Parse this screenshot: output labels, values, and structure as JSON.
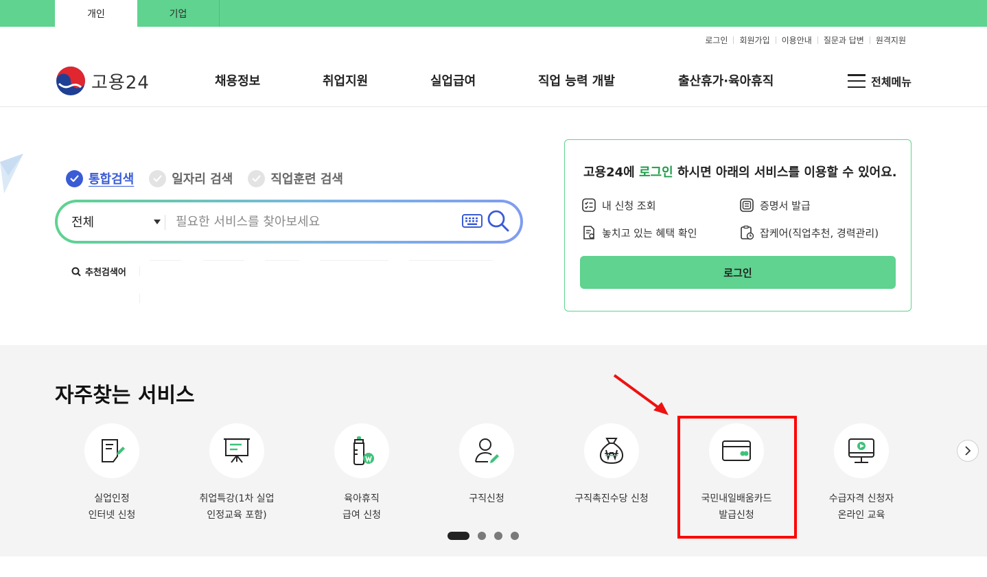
{
  "top_tabs": [
    {
      "label": "개인",
      "active": true
    },
    {
      "label": "기업",
      "active": false
    }
  ],
  "utility_links": [
    "로그인",
    "회원가입",
    "이용안내",
    "질문과 답변",
    "원격지원"
  ],
  "logo": {
    "text": "고용24"
  },
  "gnb": [
    "채용정보",
    "취업지원",
    "실업급여",
    "직업 능력 개발",
    "출산휴가·육아휴직"
  ],
  "all_menu_label": "전체메뉴",
  "search": {
    "tabs": [
      {
        "label": "통합검색",
        "active": true
      },
      {
        "label": "일자리 검색",
        "active": false
      },
      {
        "label": "직업훈련 검색",
        "active": false
      }
    ],
    "select_value": "전체",
    "placeholder": "필요한 서비스를 찾아보세요",
    "recommended_label": "추천검색어"
  },
  "login_box": {
    "message_prefix": "고용24에 ",
    "message_highlight": "로그인",
    "message_suffix": " 하시면 아래의 서비스를 이용할 수 있어요.",
    "services": [
      "내 신청 조회",
      "증명서 발급",
      "놓치고 있는 혜택 확인",
      "잡케어(직업추천, 경력관리)"
    ],
    "button_label": "로그인"
  },
  "frequent": {
    "title": "자주찾는 서비스",
    "items": [
      {
        "line1": "실업인정",
        "line2": "인터넷 신청",
        "icon": "document-pen-icon"
      },
      {
        "line1": "취업특강(1차 실업",
        "line2": "인정교육 포함)",
        "icon": "presentation-board-icon"
      },
      {
        "line1": "육아휴직",
        "line2": "급여 신청",
        "icon": "baby-bottle-won-icon"
      },
      {
        "line1": "구직신청",
        "line2": "",
        "icon": "person-pen-icon"
      },
      {
        "line1": "구직촉진수당 신청",
        "line2": "",
        "icon": "money-bag-won-icon"
      },
      {
        "line1": "국민내일배움카드",
        "line2": "발급신청",
        "icon": "card-icon"
      },
      {
        "line1": "수급자격 신청자",
        "line2": "온라인 교육",
        "icon": "monitor-play-icon"
      }
    ],
    "pagination": {
      "total": 4,
      "current": 1
    }
  },
  "colors": {
    "brand_green": "#5fd38f",
    "accent_blue": "#3a5bd6",
    "highlight_red": "#ff0000"
  }
}
